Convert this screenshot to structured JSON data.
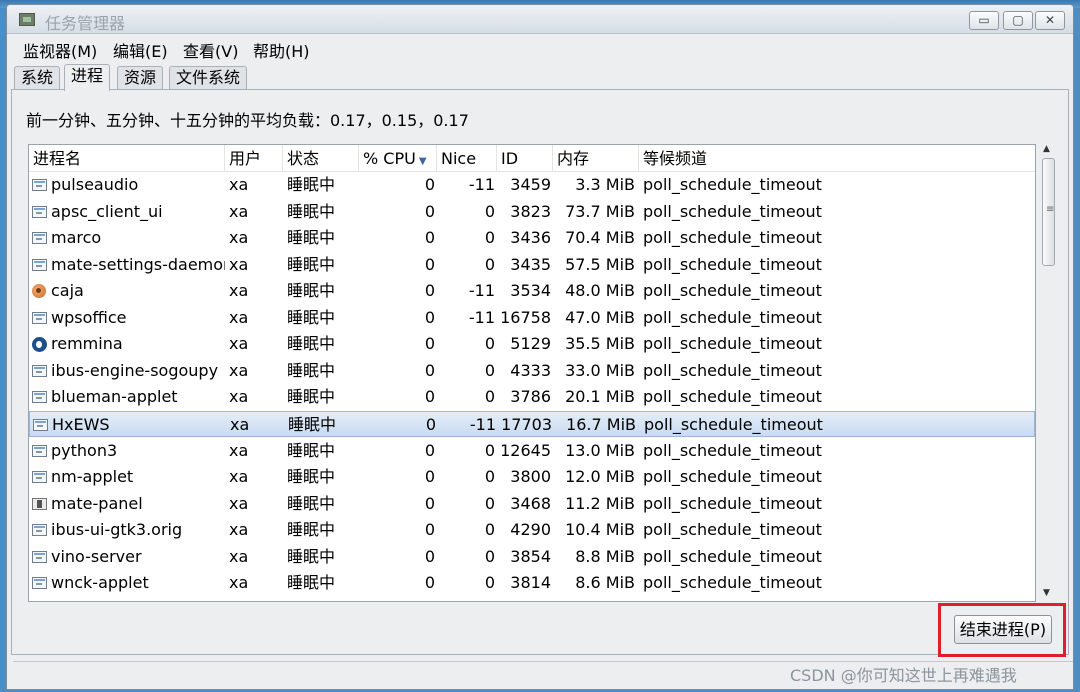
{
  "window": {
    "title": "任务管理器",
    "controls": {
      "minimize": "▭",
      "maximize": "▢",
      "close": "✕"
    }
  },
  "menu": [
    "监视器(M)",
    "编辑(E)",
    "查看(V)",
    "帮助(H)"
  ],
  "tabs": [
    {
      "label": "系统",
      "active": false
    },
    {
      "label": "进程",
      "active": true
    },
    {
      "label": "资源",
      "active": false
    },
    {
      "label": "文件系统",
      "active": false
    }
  ],
  "load_average": "前一分钟、五分钟、十五分钟的平均负载：0.17，0.15，0.17",
  "columns": {
    "name": "进程名",
    "user": "用户",
    "state": "状态",
    "cpu": "% CPU",
    "nice": "Nice",
    "id": "ID",
    "memory": "内存",
    "wchan": "等候频道"
  },
  "sort": {
    "column": "cpu",
    "direction": "descending",
    "arrow": "▼"
  },
  "processes": [
    {
      "icon": "app-window-icon",
      "name": "pulseaudio",
      "user": "xa",
      "state": "睡眠中",
      "cpu": "0",
      "nice": "-11",
      "id": "3459",
      "memory": "3.3 MiB",
      "wchan": "poll_schedule_timeout"
    },
    {
      "icon": "app-window-icon",
      "name": "apsc_client_ui",
      "user": "xa",
      "state": "睡眠中",
      "cpu": "0",
      "nice": "0",
      "id": "3823",
      "memory": "73.7 MiB",
      "wchan": "poll_schedule_timeout"
    },
    {
      "icon": "app-window-icon",
      "name": "marco",
      "user": "xa",
      "state": "睡眠中",
      "cpu": "0",
      "nice": "0",
      "id": "3436",
      "memory": "70.4 MiB",
      "wchan": "poll_schedule_timeout"
    },
    {
      "icon": "app-window-icon",
      "name": "mate-settings-daemon",
      "user": "xa",
      "state": "睡眠中",
      "cpu": "0",
      "nice": "0",
      "id": "3435",
      "memory": "57.5 MiB",
      "wchan": "poll_schedule_timeout"
    },
    {
      "icon": "caja-icon",
      "name": "caja",
      "user": "xa",
      "state": "睡眠中",
      "cpu": "0",
      "nice": "-11",
      "id": "3534",
      "memory": "48.0 MiB",
      "wchan": "poll_schedule_timeout"
    },
    {
      "icon": "app-window-icon",
      "name": "wpsoffice",
      "user": "xa",
      "state": "睡眠中",
      "cpu": "0",
      "nice": "-11",
      "id": "16758",
      "memory": "47.0 MiB",
      "wchan": "poll_schedule_timeout"
    },
    {
      "icon": "remmina-icon",
      "name": "remmina",
      "user": "xa",
      "state": "睡眠中",
      "cpu": "0",
      "nice": "0",
      "id": "5129",
      "memory": "35.5 MiB",
      "wchan": "poll_schedule_timeout"
    },
    {
      "icon": "app-window-icon",
      "name": "ibus-engine-sogoupy",
      "user": "xa",
      "state": "睡眠中",
      "cpu": "0",
      "nice": "0",
      "id": "4333",
      "memory": "33.0 MiB",
      "wchan": "poll_schedule_timeout"
    },
    {
      "icon": "app-window-icon",
      "name": "blueman-applet",
      "user": "xa",
      "state": "睡眠中",
      "cpu": "0",
      "nice": "0",
      "id": "3786",
      "memory": "20.1 MiB",
      "wchan": "poll_schedule_timeout"
    },
    {
      "icon": "app-window-icon",
      "name": "HxEWS",
      "user": "xa",
      "state": "睡眠中",
      "cpu": "0",
      "nice": "-11",
      "id": "17703",
      "memory": "16.7 MiB",
      "wchan": "poll_schedule_timeout",
      "selected": true
    },
    {
      "icon": "app-window-icon",
      "name": "python3",
      "user": "xa",
      "state": "睡眠中",
      "cpu": "0",
      "nice": "0",
      "id": "12645",
      "memory": "13.0 MiB",
      "wchan": "poll_schedule_timeout"
    },
    {
      "icon": "app-window-icon",
      "name": "nm-applet",
      "user": "xa",
      "state": "睡眠中",
      "cpu": "0",
      "nice": "0",
      "id": "3800",
      "memory": "12.0 MiB",
      "wchan": "poll_schedule_timeout"
    },
    {
      "icon": "mate-panel-icon",
      "name": "mate-panel",
      "user": "xa",
      "state": "睡眠中",
      "cpu": "0",
      "nice": "0",
      "id": "3468",
      "memory": "11.2 MiB",
      "wchan": "poll_schedule_timeout"
    },
    {
      "icon": "app-window-icon",
      "name": "ibus-ui-gtk3.orig",
      "user": "xa",
      "state": "睡眠中",
      "cpu": "0",
      "nice": "0",
      "id": "4290",
      "memory": "10.4 MiB",
      "wchan": "poll_schedule_timeout"
    },
    {
      "icon": "app-window-icon",
      "name": "vino-server",
      "user": "xa",
      "state": "睡眠中",
      "cpu": "0",
      "nice": "0",
      "id": "3854",
      "memory": "8.8 MiB",
      "wchan": "poll_schedule_timeout"
    },
    {
      "icon": "app-window-icon",
      "name": "wnck-applet",
      "user": "xa",
      "state": "睡眠中",
      "cpu": "0",
      "nice": "0",
      "id": "3814",
      "memory": "8.6 MiB",
      "wchan": "poll_schedule_timeout"
    }
  ],
  "scrollbar": {
    "up": "▲",
    "down": "▼",
    "grip": "≡"
  },
  "end_process_button": "结束进程(P)",
  "highlight_color": "#e01f2a",
  "watermark": "CSDN @你可知这世上再难遇我"
}
